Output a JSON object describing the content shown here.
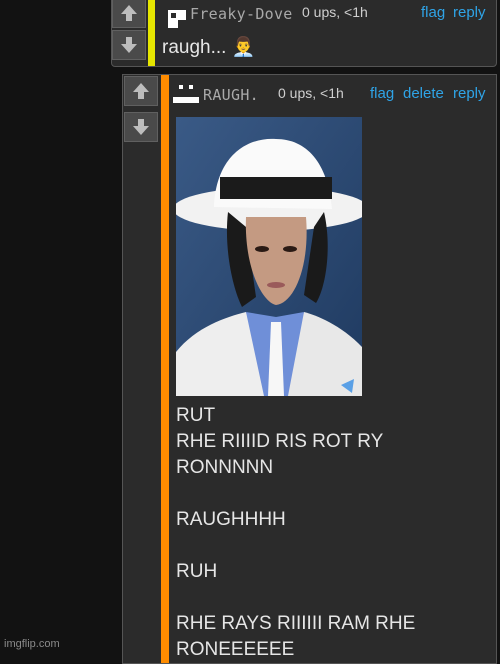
{
  "comments": [
    {
      "username": "Freaky-Dove",
      "meta": "0 ups, <1h",
      "actions": [
        "flag",
        "reply"
      ],
      "text": "raugh... 👨‍💼",
      "bar_color": "#e6e600"
    },
    {
      "username": "RAUGH.",
      "meta": "0 ups, <1h",
      "actions": [
        "flag",
        "delete",
        "reply"
      ],
      "text": "RUT\nRHE RIIIID RIS ROT RY\nRONNNNN\n\nRAUGHHHH\n\nRUH\n\nRHE RAYS RIIIIII RAM RHE\nRONEEEEEE",
      "bar_color": "#ff8c00"
    }
  ],
  "watermark": "imgflip.com",
  "icons": {
    "upvote": "arrow-up-icon",
    "downvote": "arrow-down-icon"
  }
}
